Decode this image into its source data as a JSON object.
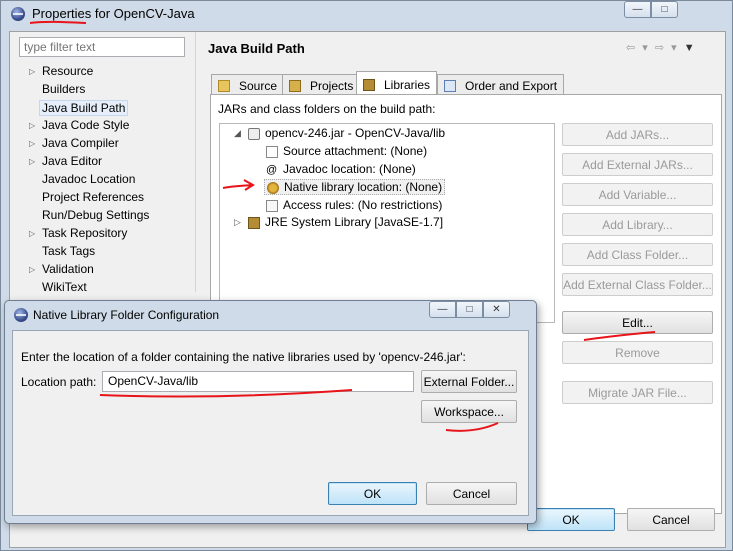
{
  "window": {
    "title_prefix": "Properties",
    "title_suffix": " for OpenCV-Java"
  },
  "sidebar": {
    "filter_placeholder": "type filter text",
    "items": [
      {
        "label": "Resource",
        "expandable": true
      },
      {
        "label": "Builders",
        "expandable": false
      },
      {
        "label": "Java Build Path",
        "expandable": false,
        "selected": true
      },
      {
        "label": "Java Code Style",
        "expandable": true
      },
      {
        "label": "Java Compiler",
        "expandable": true
      },
      {
        "label": "Java Editor",
        "expandable": true
      },
      {
        "label": "Javadoc Location",
        "expandable": false
      },
      {
        "label": "Project References",
        "expandable": false
      },
      {
        "label": "Run/Debug Settings",
        "expandable": false
      },
      {
        "label": "Task Repository",
        "expandable": true
      },
      {
        "label": "Task Tags",
        "expandable": false
      },
      {
        "label": "Validation",
        "expandable": true
      },
      {
        "label": "WikiText",
        "expandable": false
      }
    ]
  },
  "main": {
    "heading": "Java Build Path",
    "tabs": [
      {
        "label": "Source"
      },
      {
        "label": "Projects"
      },
      {
        "label": "Libraries",
        "active": true
      },
      {
        "label": "Order and Export"
      }
    ],
    "panel_caption": "JARs and class folders on the build path:",
    "tree": {
      "jar": "opencv-246.jar - OpenCV-Java/lib",
      "children": [
        "Source attachment: (None)",
        "Javadoc location: (None)",
        "Native library location: (None)",
        "Access rules: (No restrictions)"
      ],
      "jre": "JRE System Library [JavaSE-1.7]"
    },
    "buttons": {
      "add_jars": "Add JARs...",
      "add_external_jars": "Add External JARs...",
      "add_variable": "Add Variable...",
      "add_library": "Add Library...",
      "add_class_folder": "Add Class Folder...",
      "add_external_class_folder": "Add External Class Folder...",
      "edit": "Edit...",
      "remove": "Remove",
      "migrate_jar": "Migrate JAR File..."
    }
  },
  "footer": {
    "ok": "OK",
    "cancel": "Cancel"
  },
  "dialog": {
    "title": "Native Library Folder Configuration",
    "description": "Enter the location of a folder containing the native libraries used by 'opencv-246.jar':",
    "location_label": "Location path:",
    "location_value": "OpenCV-Java/lib",
    "external_folder": "External Folder...",
    "workspace": "Workspace...",
    "ok": "OK",
    "cancel": "Cancel"
  },
  "colors": {
    "annotation_red": "#e8141a",
    "title_bar": "#cfdbe8",
    "default_button": "#bfe3f8"
  }
}
